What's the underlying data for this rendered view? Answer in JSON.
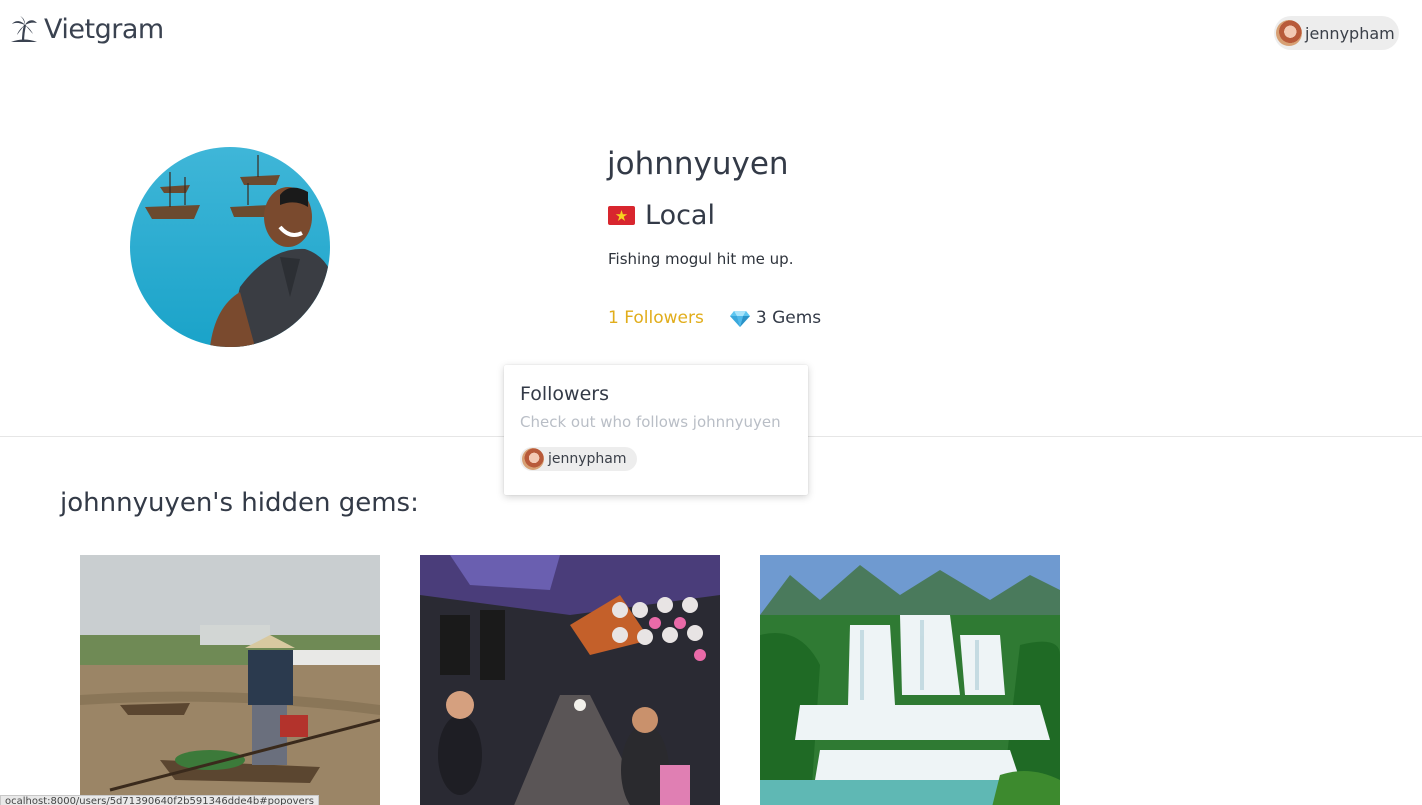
{
  "nav": {
    "brand": "Vietgram",
    "brand_icon": "palm-island-icon",
    "current_user": "jennypham"
  },
  "profile": {
    "username": "johnnyuyen",
    "status_flag": "vietnam-flag-icon",
    "status": "Local",
    "bio": "Fishing mogul hit me up.",
    "followers_label": "1 Followers",
    "gems_icon": "gem-icon",
    "gems_label": "3 Gems"
  },
  "popover": {
    "title": "Followers",
    "subtitle": "Check out who follows johnnyuyen",
    "followers": [
      "jennypham"
    ]
  },
  "gems_section": {
    "heading": "johnnyuyen's hidden gems:",
    "cards": [
      {
        "image": "floating-market-photo"
      },
      {
        "image": "street-market-photo"
      },
      {
        "image": "waterfall-photo"
      }
    ]
  },
  "status_bar": {
    "url": "ocalhost:8000/users/5d71390640f2b591346dde4b#popovers"
  },
  "colors": {
    "accent_followers": "#e1ad1b",
    "text": "#333a47",
    "muted": "#b9bec6",
    "chip_bg": "#ededed"
  }
}
